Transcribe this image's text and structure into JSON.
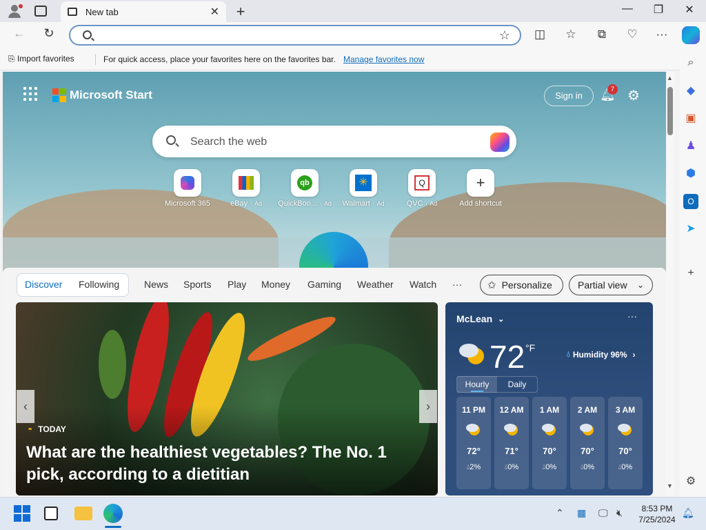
{
  "browser": {
    "tab_title": "New tab",
    "address_value": "",
    "favorites_bar": {
      "import_label": "Import favorites",
      "message": "For quick access, place your favorites here on the favorites bar.",
      "manage_link": "Manage favorites now"
    }
  },
  "start": {
    "brand": "Microsoft Start",
    "sign_in": "Sign in",
    "notification_count": "7",
    "search_placeholder": "Search the web",
    "quick_links": [
      {
        "label": "Microsoft 365",
        "ad": ""
      },
      {
        "label": "eBay",
        "ad": "Ad"
      },
      {
        "label": "QuickBoo...",
        "ad": "Ad"
      },
      {
        "label": "Walmart",
        "ad": "Ad"
      },
      {
        "label": "QVC",
        "ad": "Ad"
      },
      {
        "label": "Add shortcut",
        "ad": ""
      }
    ]
  },
  "feed": {
    "tabs": [
      "Discover",
      "Following"
    ],
    "nav": [
      "News",
      "Sports",
      "Play",
      "Money",
      "Gaming",
      "Weather",
      "Watch",
      "···"
    ],
    "personalize": "Personalize",
    "view": "Partial view",
    "hero": {
      "source": "TODAY",
      "headline": "What are the healthiest vegetables? The No. 1 pick, according to a dietitian"
    }
  },
  "weather": {
    "city": "McLean",
    "temp": "72",
    "unit": "°F",
    "humidity": "Humidity 96%",
    "tabs": [
      "Hourly",
      "Daily"
    ],
    "hours": [
      {
        "time": "11 PM",
        "temp": "72°",
        "precip": "2%"
      },
      {
        "time": "12 AM",
        "temp": "71°",
        "precip": "0%"
      },
      {
        "time": "1 AM",
        "temp": "70°",
        "precip": "0%"
      },
      {
        "time": "2 AM",
        "temp": "70°",
        "precip": "0%"
      },
      {
        "time": "3 AM",
        "temp": "70°",
        "precip": "0%"
      }
    ]
  },
  "taskbar": {
    "time": "8:53 PM",
    "date": "7/25/2024"
  },
  "colors": {
    "accent": "#0f6cbd",
    "weather_bg": "#2f4d7a",
    "badge": "#d13438"
  }
}
